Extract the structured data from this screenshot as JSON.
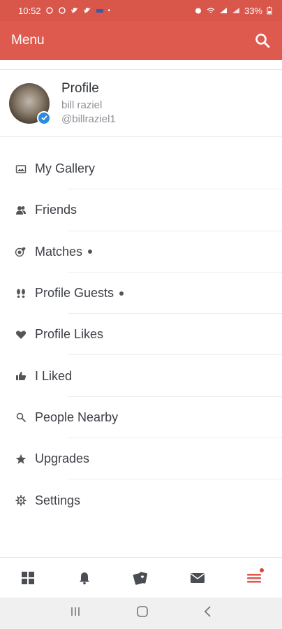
{
  "status_bar": {
    "time": "10:52",
    "battery": "33%"
  },
  "app_bar": {
    "title": "Menu",
    "search_icon": "search-icon"
  },
  "profile": {
    "title": "Profile",
    "name": "bill raziel",
    "handle": "@billraziel1",
    "verified": true
  },
  "menu": {
    "items": [
      {
        "label": "My Gallery",
        "icon": "gallery-icon",
        "has_dot": false
      },
      {
        "label": "Friends",
        "icon": "friends-icon",
        "has_dot": false
      },
      {
        "label": "Matches",
        "icon": "matches-icon",
        "has_dot": true
      },
      {
        "label": "Profile Guests",
        "icon": "footprints-icon",
        "has_dot": true
      },
      {
        "label": "Profile Likes",
        "icon": "heart-icon",
        "has_dot": false
      },
      {
        "label": "I Liked",
        "icon": "thumbs-up-icon",
        "has_dot": false
      },
      {
        "label": "People Nearby",
        "icon": "search-icon",
        "has_dot": false
      },
      {
        "label": "Upgrades",
        "icon": "star-icon",
        "has_dot": false
      },
      {
        "label": "Settings",
        "icon": "gear-icon",
        "has_dot": false
      }
    ]
  },
  "bottom_nav": {
    "items": [
      {
        "icon": "grid-icon"
      },
      {
        "icon": "bell-icon"
      },
      {
        "icon": "cards-icon"
      },
      {
        "icon": "mail-icon"
      },
      {
        "icon": "menu-icon",
        "active": true,
        "has_dot": true
      }
    ]
  },
  "colors": {
    "accent": "#de5a4e",
    "status_bar": "#d9564a",
    "verified": "#2a8be0",
    "text": "#3c3f45",
    "muted": "#8d9096"
  }
}
